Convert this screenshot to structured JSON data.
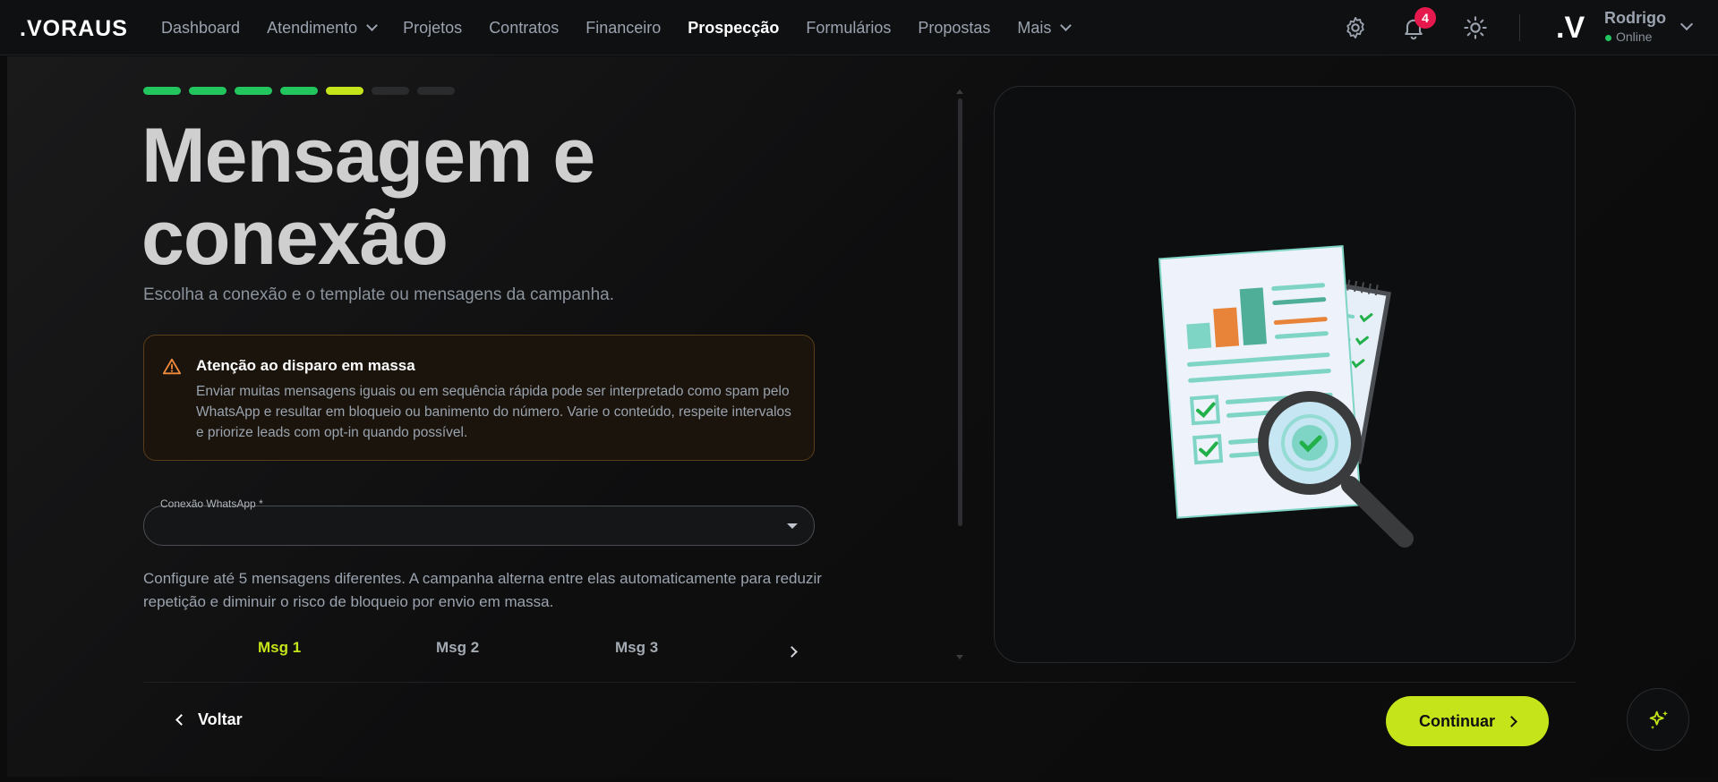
{
  "brand": {
    "logo": ".VORAUS",
    "accent": "#c6e41a"
  },
  "nav": {
    "items": [
      {
        "label": "Dashboard",
        "active": false,
        "dropdown": false
      },
      {
        "label": "Atendimento",
        "active": false,
        "dropdown": true
      },
      {
        "label": "Projetos",
        "active": false,
        "dropdown": false
      },
      {
        "label": "Contratos",
        "active": false,
        "dropdown": false
      },
      {
        "label": "Financeiro",
        "active": false,
        "dropdown": false
      },
      {
        "label": "Prospecção",
        "active": true,
        "dropdown": false
      },
      {
        "label": "Formulários",
        "active": false,
        "dropdown": false
      },
      {
        "label": "Propostas",
        "active": false,
        "dropdown": false
      },
      {
        "label": "Mais",
        "active": false,
        "dropdown": true
      }
    ]
  },
  "topbar": {
    "icons": [
      "gear-icon",
      "bell-icon",
      "sun-icon"
    ],
    "notification_count": "4",
    "user": {
      "avatar": ".V",
      "name": "Rodrigo",
      "status": "Online"
    }
  },
  "wizard": {
    "steps_total": 7,
    "steps_done": 4,
    "current_step": 5,
    "title": "Mensagem e conexão",
    "subtitle": "Escolha a conexão e o template ou mensagens da campanha."
  },
  "warning": {
    "icon": "warning-triangle-icon",
    "title": "Atenção ao disparo em massa",
    "body": "Enviar muitas mensagens iguais ou em sequência rápida pode ser interpretado como spam pelo WhatsApp e resultar em bloqueio ou banimento do número. Varie o conteúdo, respeite intervalos e priorize leads com opt-in quando possível."
  },
  "connection": {
    "label": "Conexão WhatsApp *",
    "value": ""
  },
  "help_text": "Configure até 5 mensagens diferentes. A campanha alterna entre elas automaticamente para reduzir repetição e diminuir o risco de bloqueio por envio em massa.",
  "message_tabs": [
    {
      "label": "Msg 1",
      "active": true
    },
    {
      "label": "Msg 2",
      "active": false
    },
    {
      "label": "Msg 3",
      "active": false
    }
  ],
  "footer": {
    "back": "Voltar",
    "continue": "Continuar"
  }
}
